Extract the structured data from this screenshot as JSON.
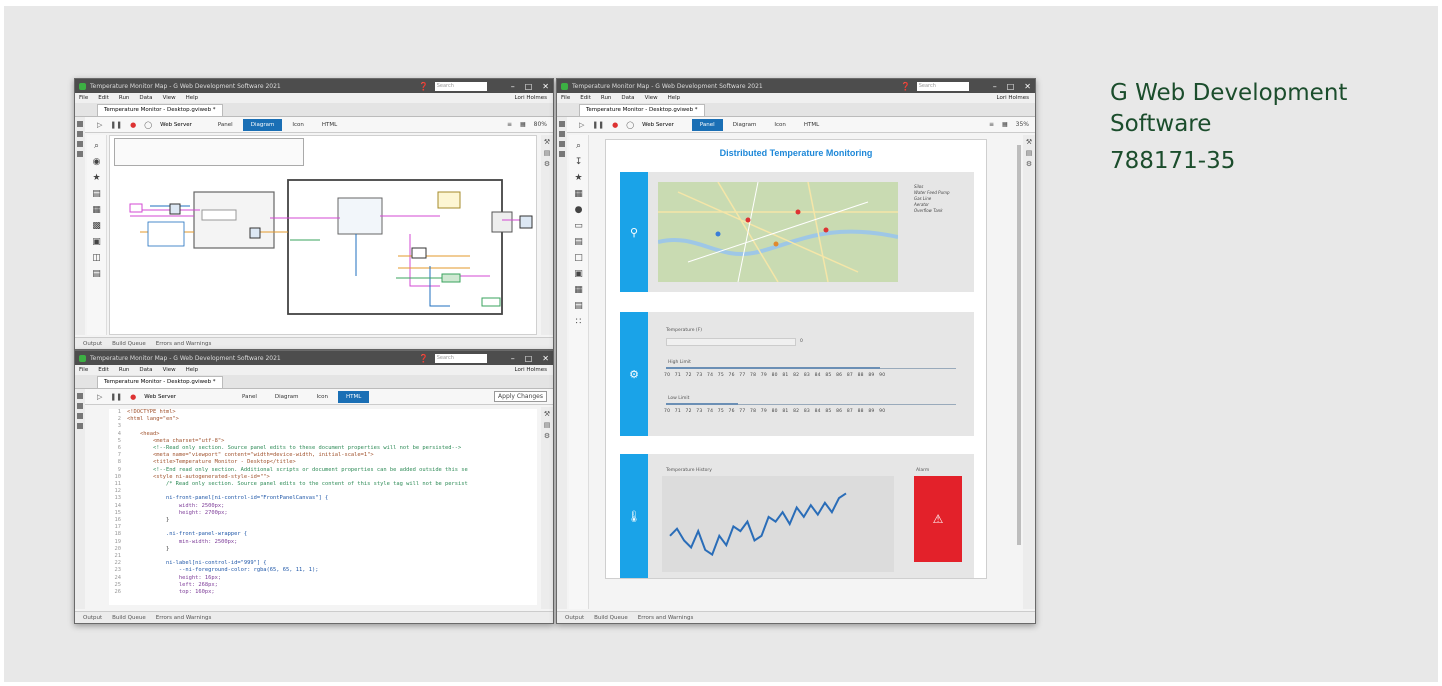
{
  "caption": {
    "line1": "G Web Development",
    "line2": "Software",
    "part_number": "788171-35"
  },
  "diagram_window": {
    "title": "Temperature Monitor Map - G Web Development Software 2021",
    "menu": [
      "File",
      "Edit",
      "Run",
      "Data",
      "View",
      "Help"
    ],
    "user": "Lori Holmes",
    "doc_tab": "Temperature Monitor - Desktop.gviweb *",
    "server": "Web Server",
    "view_tabs": [
      "Panel",
      "Diagram",
      "Icon",
      "HTML"
    ],
    "active_view": "Diagram",
    "zoom": "80%",
    "status_items": [
      "Output",
      "Build Queue",
      "Errors and Warnings"
    ]
  },
  "code_window": {
    "title": "Temperature Monitor Map - G Web Development Software 2021",
    "menu": [
      "File",
      "Edit",
      "Run",
      "Data",
      "View",
      "Help"
    ],
    "user": "Lori Holmes",
    "doc_tab": "Temperature Monitor - Desktop.gviweb *",
    "server": "Web Server",
    "view_tabs": [
      "Panel",
      "Diagram",
      "Icon",
      "HTML"
    ],
    "active_view": "HTML",
    "apply_button": "Apply Changes",
    "status_items": [
      "Output",
      "Build Queue",
      "Errors and Warnings"
    ],
    "lines": [
      {
        "n": "1",
        "t": "<!DOCTYPE html>"
      },
      {
        "n": "2",
        "t": "<html lang=\"en\">"
      },
      {
        "n": "3",
        "t": ""
      },
      {
        "n": "4",
        "t": "    <head>"
      },
      {
        "n": "5",
        "t": "        <meta charset=\"utf-8\">"
      },
      {
        "n": "6",
        "t": "        <!--Read only section. Source panel edits to these document properties will not be persisted-->"
      },
      {
        "n": "7",
        "t": "        <meta name=\"viewport\" content=\"width=device-width, initial-scale=1\">"
      },
      {
        "n": "8",
        "t": "        <title>Temperature Monitor - Desktop</title>"
      },
      {
        "n": "9",
        "t": "        <!--End read only section. Additional scripts or document properties can be added outside this se"
      },
      {
        "n": "10",
        "t": "        <style ni-autogenerated-style-id=\"\">"
      },
      {
        "n": "11",
        "t": "            /* Read only section. Source panel edits to the content of this style tag will not be persist"
      },
      {
        "n": "12",
        "t": ""
      },
      {
        "n": "13",
        "t": "            ni-front-panel[ni-control-id=\"FrontPanelCanvas\"] {"
      },
      {
        "n": "14",
        "t": "                width: 2500px;"
      },
      {
        "n": "15",
        "t": "                height: 2700px;"
      },
      {
        "n": "16",
        "t": "            }"
      },
      {
        "n": "17",
        "t": ""
      },
      {
        "n": "18",
        "t": "            .ni-front-panel-wrapper {"
      },
      {
        "n": "19",
        "t": "                min-width: 2500px;"
      },
      {
        "n": "20",
        "t": "            }"
      },
      {
        "n": "21",
        "t": ""
      },
      {
        "n": "22",
        "t": "            ni-label[ni-control-id=\"999\"] {"
      },
      {
        "n": "23",
        "t": "                --ni-foreground-color: rgba(65, 65, 11, 1);"
      },
      {
        "n": "24",
        "t": "                height: 16px;"
      },
      {
        "n": "25",
        "t": "                left: 268px;"
      },
      {
        "n": "26",
        "t": "                top: 160px;"
      }
    ]
  },
  "panel_window": {
    "title": "Temperature Monitor Map - G Web Development Software 2021",
    "menu": [
      "File",
      "Edit",
      "Run",
      "Data",
      "View",
      "Help"
    ],
    "user": "Lori Holmes",
    "doc_tab": "Temperature Monitor - Desktop.gviweb *",
    "server": "Web Server",
    "view_tabs": [
      "Panel",
      "Diagram",
      "Icon",
      "HTML"
    ],
    "active_view": "Panel",
    "zoom": "35%",
    "status_items": [
      "Output",
      "Build Queue",
      "Errors and Warnings"
    ],
    "panel_title": "Distributed Temperature Monitoring",
    "map_legend": [
      "Silos",
      "Water Feed Pump",
      "Gas Line",
      "Aerator",
      "Overflow Tank"
    ],
    "temperature_label": "Temperature (F)",
    "temperature_value": "0",
    "high_limit_label": "High Limit",
    "low_limit_label": "Low Limit",
    "scale_ticks": "70 71 72 73 74 75 76 77 78 79 80 81 82 83 84 85 86 87 88 89 90",
    "history_label": "Temperature History",
    "alarm_label": "Alarm",
    "icons": {
      "map": "map-pin-icon",
      "settings": "gear-icon",
      "thermo": "thermometer-icon",
      "alarm": "warning-icon"
    }
  },
  "chart_data": {
    "type": "line",
    "title": "Temperature History",
    "series": [
      {
        "values": [
          68,
          71,
          66,
          63,
          70,
          62,
          60,
          68,
          64,
          72,
          70,
          74,
          66,
          68,
          76,
          74,
          78,
          73,
          80,
          76,
          81,
          77,
          82,
          78,
          84,
          86
        ]
      }
    ]
  }
}
